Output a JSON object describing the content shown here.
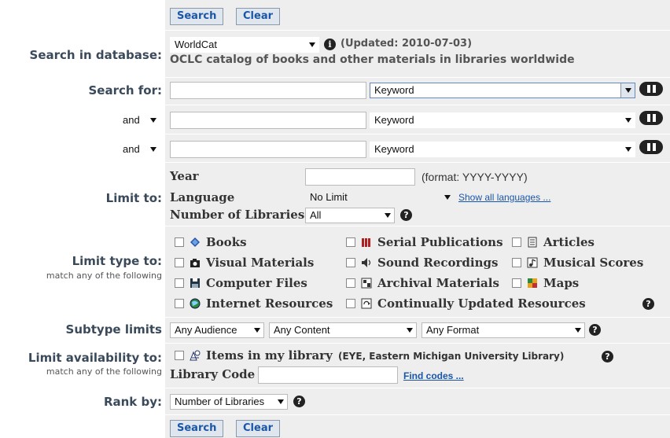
{
  "buttons": {
    "search": "Search",
    "clear": "Clear"
  },
  "database": {
    "label": "Search in database:",
    "selected": "WorldCat",
    "updated": "(Updated: 2010-07-03)",
    "description": "OCLC catalog of books and other materials in libraries worldwide"
  },
  "search_for": {
    "label": "Search for:",
    "rows": [
      {
        "operator": "",
        "value": "",
        "index": "Keyword"
      },
      {
        "operator": "and",
        "value": "",
        "index": "Keyword"
      },
      {
        "operator": "and",
        "value": "",
        "index": "Keyword"
      }
    ]
  },
  "limit_to": {
    "label": "Limit to:",
    "year_label": "Year",
    "year_value": "",
    "year_format": "(format: YYYY-YYYY)",
    "language_label": "Language",
    "language_value": "No Limit",
    "show_languages": "Show all languages ...",
    "libraries_label": "Number of Libraries",
    "libraries_value": "All"
  },
  "limit_type": {
    "label": "Limit type to:",
    "sublabel": "match any of the following",
    "items": [
      "Books",
      "Serial Publications",
      "Articles",
      "Visual Materials",
      "Sound Recordings",
      "Musical Scores",
      "Computer Files",
      "Archival Materials",
      "Maps",
      "Internet Resources",
      "Continually Updated Resources"
    ]
  },
  "subtype": {
    "label": "Subtype limits",
    "audience": "Any Audience",
    "content": "Any Content",
    "format": "Any Format"
  },
  "availability": {
    "label": "Limit availability to:",
    "sublabel": "match any of the following",
    "items_label": "Items in my library",
    "library_name": "(EYE, Eastern Michigan University Library)",
    "code_label": "Library Code",
    "code_value": "",
    "find_codes": "Find codes ..."
  },
  "rank": {
    "label": "Rank by:",
    "value": "Number of Libraries"
  },
  "help_glyph": "?",
  "info_glyph": "i"
}
